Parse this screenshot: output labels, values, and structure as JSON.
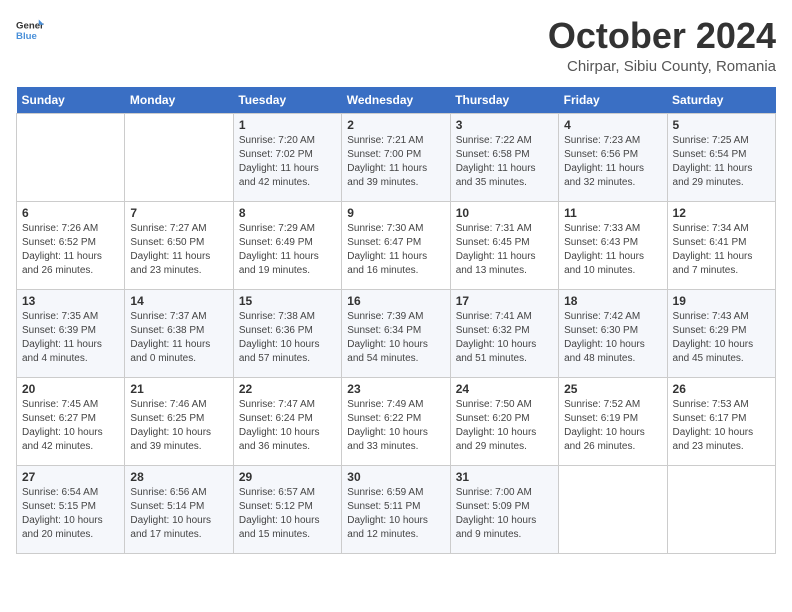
{
  "logo": {
    "general": "General",
    "blue": "Blue"
  },
  "title": "October 2024",
  "location": "Chirpar, Sibiu County, Romania",
  "days_of_week": [
    "Sunday",
    "Monday",
    "Tuesday",
    "Wednesday",
    "Thursday",
    "Friday",
    "Saturday"
  ],
  "weeks": [
    [
      {
        "day": "",
        "info": ""
      },
      {
        "day": "",
        "info": ""
      },
      {
        "day": "1",
        "info": "Sunrise: 7:20 AM\nSunset: 7:02 PM\nDaylight: 11 hours and 42 minutes."
      },
      {
        "day": "2",
        "info": "Sunrise: 7:21 AM\nSunset: 7:00 PM\nDaylight: 11 hours and 39 minutes."
      },
      {
        "day": "3",
        "info": "Sunrise: 7:22 AM\nSunset: 6:58 PM\nDaylight: 11 hours and 35 minutes."
      },
      {
        "day": "4",
        "info": "Sunrise: 7:23 AM\nSunset: 6:56 PM\nDaylight: 11 hours and 32 minutes."
      },
      {
        "day": "5",
        "info": "Sunrise: 7:25 AM\nSunset: 6:54 PM\nDaylight: 11 hours and 29 minutes."
      }
    ],
    [
      {
        "day": "6",
        "info": "Sunrise: 7:26 AM\nSunset: 6:52 PM\nDaylight: 11 hours and 26 minutes."
      },
      {
        "day": "7",
        "info": "Sunrise: 7:27 AM\nSunset: 6:50 PM\nDaylight: 11 hours and 23 minutes."
      },
      {
        "day": "8",
        "info": "Sunrise: 7:29 AM\nSunset: 6:49 PM\nDaylight: 11 hours and 19 minutes."
      },
      {
        "day": "9",
        "info": "Sunrise: 7:30 AM\nSunset: 6:47 PM\nDaylight: 11 hours and 16 minutes."
      },
      {
        "day": "10",
        "info": "Sunrise: 7:31 AM\nSunset: 6:45 PM\nDaylight: 11 hours and 13 minutes."
      },
      {
        "day": "11",
        "info": "Sunrise: 7:33 AM\nSunset: 6:43 PM\nDaylight: 11 hours and 10 minutes."
      },
      {
        "day": "12",
        "info": "Sunrise: 7:34 AM\nSunset: 6:41 PM\nDaylight: 11 hours and 7 minutes."
      }
    ],
    [
      {
        "day": "13",
        "info": "Sunrise: 7:35 AM\nSunset: 6:39 PM\nDaylight: 11 hours and 4 minutes."
      },
      {
        "day": "14",
        "info": "Sunrise: 7:37 AM\nSunset: 6:38 PM\nDaylight: 11 hours and 0 minutes."
      },
      {
        "day": "15",
        "info": "Sunrise: 7:38 AM\nSunset: 6:36 PM\nDaylight: 10 hours and 57 minutes."
      },
      {
        "day": "16",
        "info": "Sunrise: 7:39 AM\nSunset: 6:34 PM\nDaylight: 10 hours and 54 minutes."
      },
      {
        "day": "17",
        "info": "Sunrise: 7:41 AM\nSunset: 6:32 PM\nDaylight: 10 hours and 51 minutes."
      },
      {
        "day": "18",
        "info": "Sunrise: 7:42 AM\nSunset: 6:30 PM\nDaylight: 10 hours and 48 minutes."
      },
      {
        "day": "19",
        "info": "Sunrise: 7:43 AM\nSunset: 6:29 PM\nDaylight: 10 hours and 45 minutes."
      }
    ],
    [
      {
        "day": "20",
        "info": "Sunrise: 7:45 AM\nSunset: 6:27 PM\nDaylight: 10 hours and 42 minutes."
      },
      {
        "day": "21",
        "info": "Sunrise: 7:46 AM\nSunset: 6:25 PM\nDaylight: 10 hours and 39 minutes."
      },
      {
        "day": "22",
        "info": "Sunrise: 7:47 AM\nSunset: 6:24 PM\nDaylight: 10 hours and 36 minutes."
      },
      {
        "day": "23",
        "info": "Sunrise: 7:49 AM\nSunset: 6:22 PM\nDaylight: 10 hours and 33 minutes."
      },
      {
        "day": "24",
        "info": "Sunrise: 7:50 AM\nSunset: 6:20 PM\nDaylight: 10 hours and 29 minutes."
      },
      {
        "day": "25",
        "info": "Sunrise: 7:52 AM\nSunset: 6:19 PM\nDaylight: 10 hours and 26 minutes."
      },
      {
        "day": "26",
        "info": "Sunrise: 7:53 AM\nSunset: 6:17 PM\nDaylight: 10 hours and 23 minutes."
      }
    ],
    [
      {
        "day": "27",
        "info": "Sunrise: 6:54 AM\nSunset: 5:15 PM\nDaylight: 10 hours and 20 minutes."
      },
      {
        "day": "28",
        "info": "Sunrise: 6:56 AM\nSunset: 5:14 PM\nDaylight: 10 hours and 17 minutes."
      },
      {
        "day": "29",
        "info": "Sunrise: 6:57 AM\nSunset: 5:12 PM\nDaylight: 10 hours and 15 minutes."
      },
      {
        "day": "30",
        "info": "Sunrise: 6:59 AM\nSunset: 5:11 PM\nDaylight: 10 hours and 12 minutes."
      },
      {
        "day": "31",
        "info": "Sunrise: 7:00 AM\nSunset: 5:09 PM\nDaylight: 10 hours and 9 minutes."
      },
      {
        "day": "",
        "info": ""
      },
      {
        "day": "",
        "info": ""
      }
    ]
  ]
}
